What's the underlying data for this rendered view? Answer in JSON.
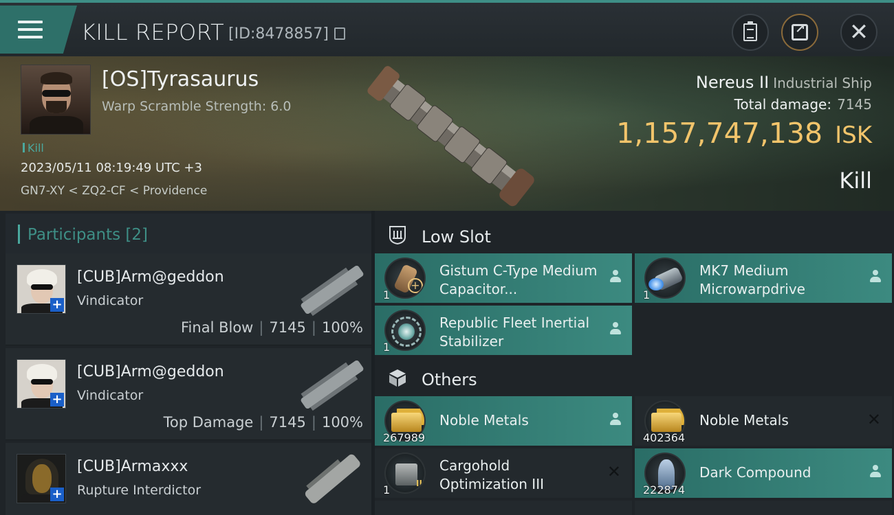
{
  "header": {
    "title": "KILL REPORT",
    "report_id": "[ID:8478857]"
  },
  "victim": {
    "name": "[OS]Tyrasaurus",
    "warp_scramble": "Warp Scramble Strength: 6.0",
    "tag": "Kill",
    "datetime": "2023/05/11 08:19:49 UTC +3",
    "location": "GN7-XY < ZQ2-CF < Providence",
    "ship_name": "Nereus II",
    "ship_class": "Industrial Ship",
    "total_damage_label": "Total damage:",
    "total_damage": "7145",
    "isk_value": "1,157,747,138",
    "isk_unit": "ISK",
    "result": "Kill"
  },
  "participants": {
    "header": "Participants [2]",
    "rows": [
      {
        "name": "[CUB]Arm@geddon",
        "ship": "Vindicator",
        "role": "Final Blow",
        "damage": "7145",
        "percent": "100%"
      },
      {
        "name": "[CUB]Arm@geddon",
        "ship": "Vindicator",
        "role": "Top Damage",
        "damage": "7145",
        "percent": "100%"
      },
      {
        "name": "[CUB]Armaxxx",
        "ship": "Rupture Interdictor",
        "role": "",
        "damage": "",
        "percent": ""
      }
    ]
  },
  "items": {
    "low_slot_header": "Low Slot",
    "others_header": "Others",
    "low_slot": [
      {
        "name": "Gistum C-Type Medium Capacitor...",
        "qty": "1",
        "status": "dropped",
        "icon": "capacitor-icon"
      },
      {
        "name": "MK7 Medium Microwarpdrive",
        "qty": "1",
        "status": "dropped",
        "icon": "microwarpdrive-icon"
      },
      {
        "name": "Republic Fleet Inertial Stabilizer",
        "qty": "1",
        "status": "dropped",
        "icon": "stabilizer-icon"
      }
    ],
    "others": [
      {
        "name": "Noble Metals",
        "qty": "267989",
        "status": "dropped",
        "icon": "noble-metals-icon"
      },
      {
        "name": "Noble Metals",
        "qty": "402364",
        "status": "destroyed",
        "icon": "noble-metals-icon"
      },
      {
        "name": "Cargohold Optimization III",
        "qty": "1",
        "status": "destroyed",
        "icon": "cargohold-icon"
      },
      {
        "name": "Dark Compound",
        "qty": "222874",
        "status": "dropped",
        "icon": "dark-compound-icon"
      }
    ]
  },
  "colors": {
    "accent": "#3e8f86",
    "isk": "#f2c46b",
    "dropped_bg": "#3c8a80",
    "destroyed_bg": "#23292d"
  }
}
